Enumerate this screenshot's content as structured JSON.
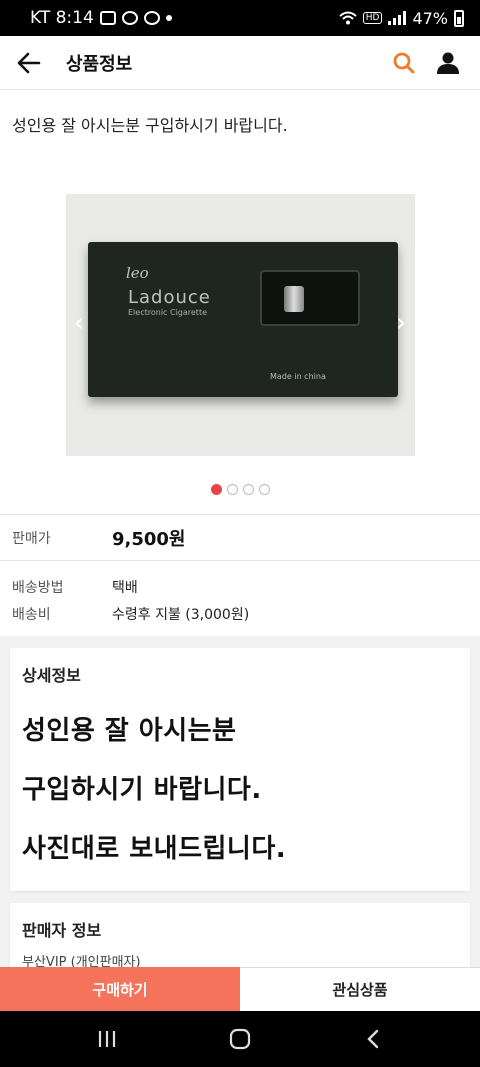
{
  "status_bar": {
    "carrier_time": "KT 8:14",
    "battery": "47%"
  },
  "header": {
    "title": "상품정보",
    "icons": {
      "back": "arrow-left-icon",
      "search": "search-icon",
      "profile": "person-icon"
    },
    "accent_color": "#f07b2c"
  },
  "notice": "성인용 잘 아시는분 구입하시기 바랍니다.",
  "gallery": {
    "image_count": 4,
    "active_index": 0,
    "photo_text": {
      "script": "leo",
      "brand": "Ladouce",
      "subtitle": "Electronic Cigarette",
      "made_in": "Made in china"
    }
  },
  "price": {
    "label": "판매가",
    "value": "9,500원"
  },
  "shipping": {
    "method_label": "배송방법",
    "method_value": "택배",
    "fee_label": "배송비",
    "fee_value": "수령후 지불 (3,000원)"
  },
  "detail": {
    "title": "상세정보",
    "lines": [
      "성인용 잘 아시는분",
      "구입하시기 바랍니다.",
      "사진대로 보내드립니다."
    ]
  },
  "seller": {
    "title": "판매자 정보",
    "name": "부산VIP (개인판매자)"
  },
  "bottom": {
    "buy_label": "구매하기",
    "wish_label": "관심상품",
    "buy_color": "#f4735a"
  }
}
